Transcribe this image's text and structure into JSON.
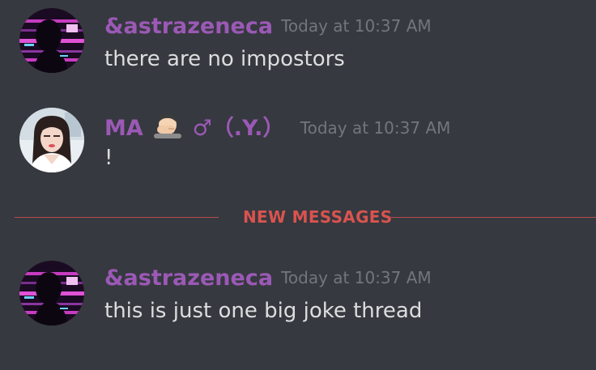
{
  "messages": [
    {
      "username": "&astrazeneca",
      "username_color": "#9b59b6",
      "timestamp": "Today at 10:37 AM",
      "content": "there are no impostors",
      "avatar_icon": "anime-glitch-avatar"
    },
    {
      "username_prefix": "MA",
      "username_suffix": "♂（.Y.）",
      "username_emoji": "man-facepalming-emoji",
      "username_color": "#9b59b6",
      "timestamp": "Today at 10:37 AM",
      "content": "!",
      "avatar_icon": "woman-photo-avatar"
    },
    {
      "username": "&astrazeneca",
      "username_color": "#9b59b6",
      "timestamp": "Today at 10:37 AM",
      "content": "this is just one big joke thread",
      "avatar_icon": "anime-glitch-avatar"
    }
  ],
  "divider": {
    "label": "NEW MESSAGES",
    "color": "#d9534f"
  }
}
